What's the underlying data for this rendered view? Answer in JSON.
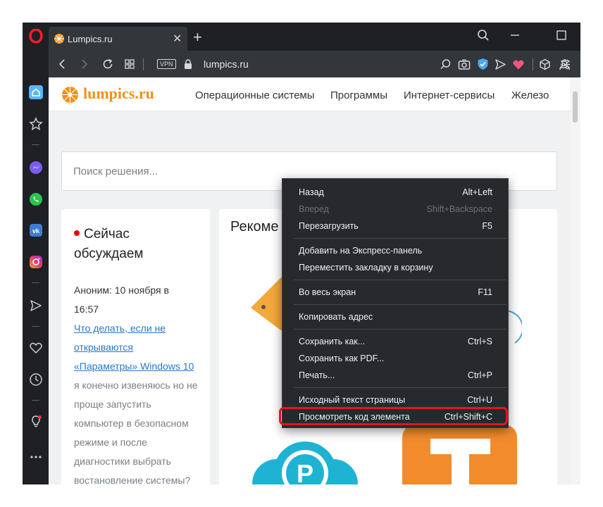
{
  "browser": {
    "tab_title": "Lumpics.ru",
    "url": "lumpics.ru",
    "vpn_badge": "VPN",
    "accent": "#e8141b"
  },
  "site": {
    "logo_text": "lumpics.ru",
    "brand_color": "#f29116",
    "nav": [
      "Операционные системы",
      "Программы",
      "Интернет-сервисы",
      "Железо"
    ],
    "search_placeholder": "Поиск решения...",
    "discussion": {
      "title_line1": "Сейчас",
      "title_line2": "обсуждаем",
      "author_line1": "Аноним: 10 ноября в",
      "author_line2": "16:57",
      "link_line1": "Что делать, если не",
      "link_line2": "открываются",
      "link_line3": "«Параметры» Windows 10",
      "msg_lines": [
        "я конечно извеняюсь но не",
        "проще запустить",
        "компьютер в безопасном",
        "режиме и после",
        "диагностики выбрать",
        "востановление системы?"
      ]
    },
    "main_heading": "Рекоме"
  },
  "context_menu": {
    "items": [
      {
        "label": "Назад",
        "shortcut": "Alt+Left",
        "disabled": false
      },
      {
        "label": "Вперед",
        "shortcut": "Shift+Backspace",
        "disabled": true
      },
      {
        "label": "Перезагрузить",
        "shortcut": "F5",
        "disabled": false
      },
      {
        "label": "Добавить на Экспресс-панель",
        "shortcut": "",
        "disabled": false
      },
      {
        "label": "Переместить закладку в корзину",
        "shortcut": "",
        "disabled": false
      },
      {
        "label": "Во весь экран",
        "shortcut": "F11",
        "disabled": false
      },
      {
        "label": "Копировать адрес",
        "shortcut": "",
        "disabled": false
      },
      {
        "label": "Сохранить как...",
        "shortcut": "Ctrl+S",
        "disabled": false
      },
      {
        "label": "Сохранить как PDF...",
        "shortcut": "",
        "disabled": false
      },
      {
        "label": "Печать...",
        "shortcut": "Ctrl+P",
        "disabled": false
      },
      {
        "label": "Исходный текст страницы",
        "shortcut": "Ctrl+U",
        "disabled": false
      },
      {
        "label": "Просмотреть код элемента",
        "shortcut": "Ctrl+Shift+C",
        "disabled": false
      }
    ]
  },
  "icons": {
    "sidebar": [
      "opera-logo-icon",
      "home-icon",
      "bookmark-star-icon",
      "messenger-icon",
      "whatsapp-icon",
      "vk-icon",
      "instagram-icon",
      "send-icon",
      "heart-icon",
      "history-clock-icon",
      "lightbulb-icon",
      "more-icon"
    ]
  }
}
